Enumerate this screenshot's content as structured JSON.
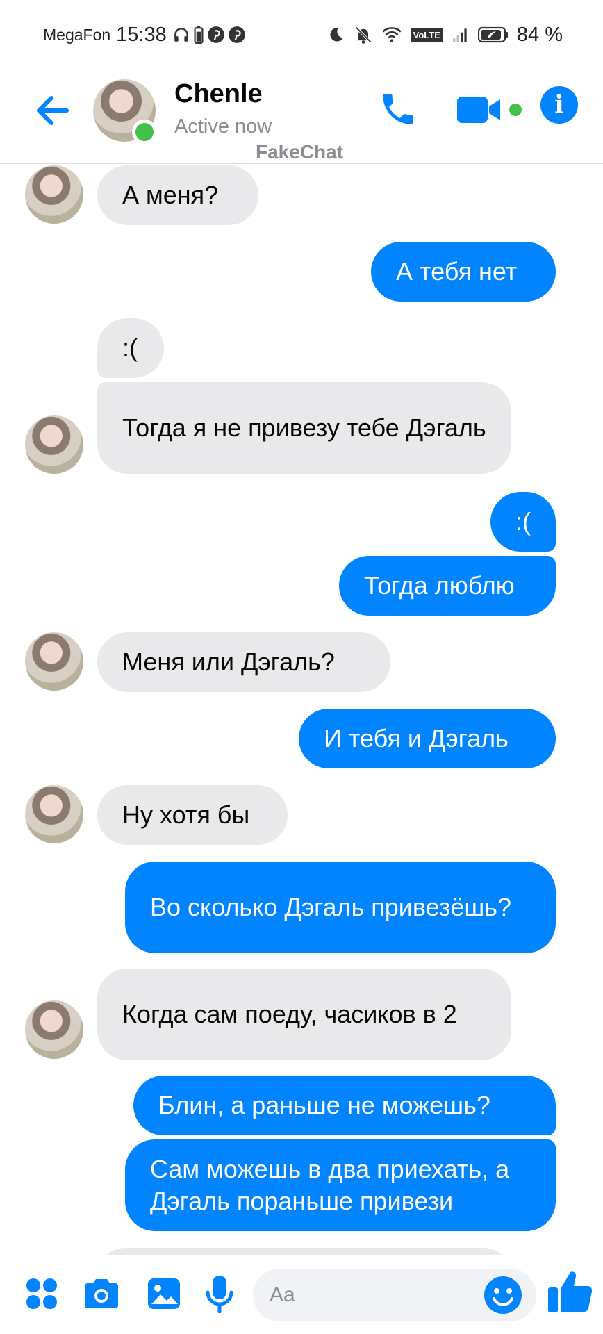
{
  "status_bar": {
    "carrier": "MegaFon",
    "time": "15:38",
    "network_badge": "VoLTE",
    "battery": "84 %"
  },
  "header": {
    "contact_name": "Chenle",
    "contact_status": "Active now",
    "watermark": "FakeChat"
  },
  "colors": {
    "accent": "#0084ff",
    "incoming_bubble": "#e9e9eb",
    "online": "#44c14a"
  },
  "messages": [
    {
      "side": "in",
      "text": "А меня?"
    },
    {
      "side": "out",
      "text": "А тебя нет"
    },
    {
      "side": "in",
      "text": ":("
    },
    {
      "side": "in",
      "text": "Тогда я не привезу тебе Дэгаль"
    },
    {
      "side": "out",
      "text": ":("
    },
    {
      "side": "out",
      "text": "Тогда люблю"
    },
    {
      "side": "in",
      "text": "Меня или Дэгаль?"
    },
    {
      "side": "out",
      "text": "И тебя и Дэгаль"
    },
    {
      "side": "in",
      "text": "Ну хотя бы"
    },
    {
      "side": "out",
      "text": "Во сколько Дэгаль привезёшь?"
    },
    {
      "side": "in",
      "text": "Когда сам поеду, часиков в 2"
    },
    {
      "side": "out",
      "text": "Блин, а раньше не можешь?"
    },
    {
      "side": "out",
      "text": "Сам можешь в два приехать, а Дэгаль пораньше привези"
    }
  ],
  "composer": {
    "placeholder": "Aa",
    "icons": [
      "apps-icon",
      "camera-icon",
      "gallery-icon",
      "microphone-icon",
      "emoji-icon",
      "thumbs-up-icon"
    ]
  }
}
